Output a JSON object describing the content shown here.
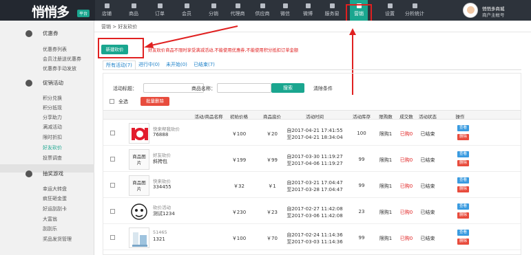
{
  "brand": {
    "name": "悄悄多",
    "badge": "平台"
  },
  "nav": [
    {
      "label": "店铺",
      "icon": "shop-icon"
    },
    {
      "label": "商品",
      "icon": "bag-icon"
    },
    {
      "label": "订单",
      "icon": "order-icon"
    },
    {
      "label": "会员",
      "icon": "user-icon"
    },
    {
      "label": "分销",
      "icon": "share-icon"
    },
    {
      "label": "代理商",
      "icon": "agent-icon"
    },
    {
      "label": "供应商",
      "icon": "supplier-icon"
    },
    {
      "label": "微信",
      "icon": "wechat-icon"
    },
    {
      "label": "微博",
      "icon": "weibo-icon"
    },
    {
      "label": "服务窗",
      "icon": "window-icon"
    },
    {
      "label": "营销",
      "icon": "marketing-icon"
    },
    {
      "label": "设置",
      "icon": "gear-icon"
    },
    {
      "label": "分析统计",
      "icon": "chart-icon"
    }
  ],
  "user": {
    "name": "悄悄多商城",
    "role": "商户主帐号"
  },
  "sidebar": {
    "groups": [
      {
        "title": "优惠券",
        "icon": "coupon-icon",
        "items": [
          "优惠券列表",
          "会员注册送优惠券",
          "优惠券手动发放"
        ]
      },
      {
        "title": "促销活动",
        "icon": "promo-icon",
        "items": [
          "积分兑换",
          "积分抵现",
          "分享助力",
          "满减活动",
          "限时折扣",
          "好友砍价",
          "投票调查"
        ]
      },
      {
        "title": "抽奖游戏",
        "icon": "game-icon",
        "items": [
          "幸运大转盘",
          "疯狂砸金蛋",
          "好运刮刮卡",
          "大富翁",
          "刮刮乐",
          "奖品发货管理"
        ]
      }
    ]
  },
  "breadcrumb": {
    "parent": "营销",
    "sep": ">",
    "current": "好友砍价"
  },
  "new_button": "新建砍价",
  "warning": "好友砍价商品不限时享受满减活动,不能使用优惠券,不能使用积分抵扣订单金额",
  "tabs": [
    "所有活动(7)",
    "进行中(0)",
    "未开始(0)",
    "已结束(7)"
  ],
  "filter": {
    "title_label": "活动标题：",
    "product_label": "商品名称：",
    "search_button": "搜索",
    "clear_label": "清除条件",
    "select_all": "全选",
    "batch_delete": "批量删除"
  },
  "columns": [
    "活动/商品名称",
    "初始价格",
    "商品底价",
    "活动时间",
    "活动库存",
    "限购数",
    "成交数",
    "活动状态",
    "操作"
  ],
  "rows": [
    {
      "title": "快来帮我砍价",
      "name": "76888",
      "initial": "￥100",
      "floor": "￥20",
      "start": "自2017-04-21 17:41:55",
      "end": "至2017-04-21 18:34:04",
      "stock": "100",
      "limit": "限购1",
      "deals": "已购0",
      "status": "已结束",
      "thumb": "ioi"
    },
    {
      "title": "好友砍价",
      "name": "斜挎包",
      "initial": "￥199",
      "floor": "￥99",
      "start": "自2017-03-30 11:19:27",
      "end": "至2017-04-06 11:19:27",
      "stock": "99",
      "limit": "限购1",
      "deals": "已购0",
      "status": "已结束",
      "thumb": "商品图片"
    },
    {
      "title": "快来砍价",
      "name": "334455",
      "initial": "￥32",
      "floor": "￥1",
      "start": "自2017-03-21 17:04:47",
      "end": "至2017-03-28 17:04:47",
      "stock": "99",
      "limit": "限购1",
      "deals": "已购0",
      "status": "已结束",
      "thumb": "商品图片"
    },
    {
      "title": "砍价活动",
      "name": "测试1234",
      "initial": "￥230",
      "floor": "￥23",
      "start": "自2017-02-27 11:42:08",
      "end": "至2017-03-06 11:42:08",
      "stock": "23",
      "limit": "限购1",
      "deals": "已购0",
      "status": "已结束",
      "thumb": "cartoon"
    },
    {
      "title": "51465",
      "name": "1321",
      "initial": "￥100",
      "floor": "￥70",
      "start": "自2017-02-24 11:14:36",
      "end": "至2017-03-03 11:14:36",
      "stock": "99",
      "limit": "限购1",
      "deals": "已购0",
      "status": "已结束",
      "thumb": "product"
    }
  ],
  "actions": {
    "view": "查看",
    "delete": "删除"
  },
  "colors": {
    "accent": "#1aa68f",
    "danger": "#e84c3d",
    "link": "#1a7fc8",
    "topbar": "#2d333b"
  }
}
